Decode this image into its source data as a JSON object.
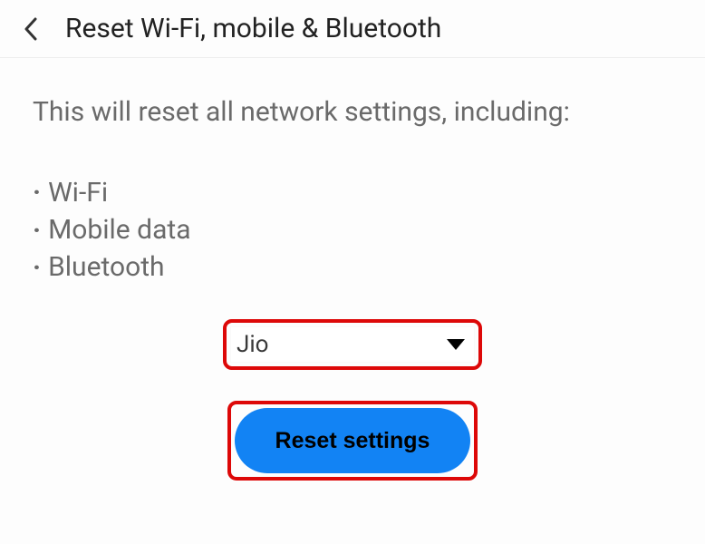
{
  "header": {
    "title": "Reset Wi-Fi, mobile & Bluetooth"
  },
  "content": {
    "description": "This will reset all network settings, including:",
    "reset_items": [
      "Wi-Fi",
      "Mobile data",
      "Bluetooth"
    ]
  },
  "sim_select": {
    "selected": "Jio"
  },
  "reset_button": {
    "label": "Reset settings"
  }
}
